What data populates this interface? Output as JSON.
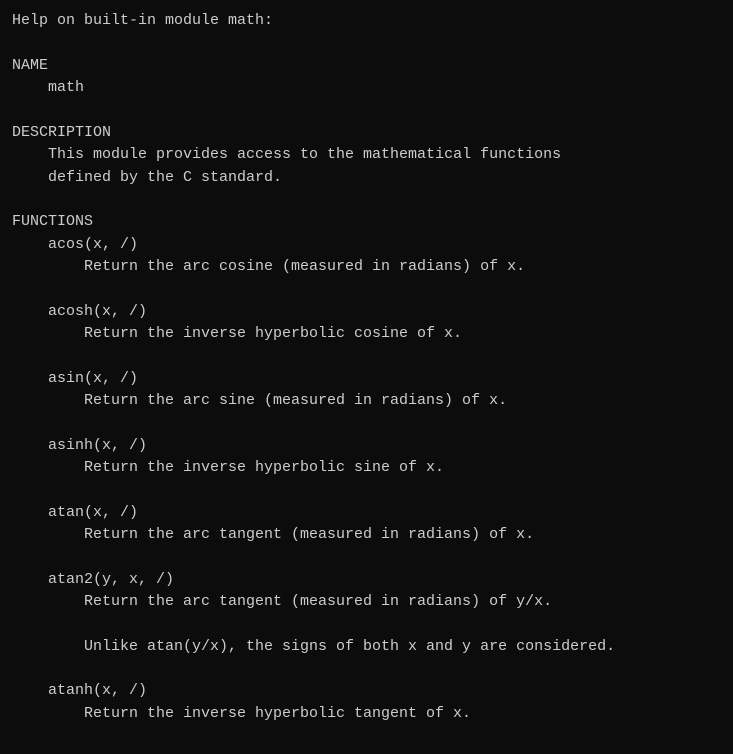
{
  "header": "Help on built-in module math:",
  "sections": {
    "name": {
      "title": "NAME",
      "value": "math"
    },
    "description": {
      "title": "DESCRIPTION",
      "lines": [
        "This module provides access to the mathematical functions",
        "defined by the C standard."
      ]
    },
    "functions": {
      "title": "FUNCTIONS",
      "items": [
        {
          "signature": "acos(x, /)",
          "desc": "Return the arc cosine (measured in radians) of x."
        },
        {
          "signature": "acosh(x, /)",
          "desc": "Return the inverse hyperbolic cosine of x."
        },
        {
          "signature": "asin(x, /)",
          "desc": "Return the arc sine (measured in radians) of x."
        },
        {
          "signature": "asinh(x, /)",
          "desc": "Return the inverse hyperbolic sine of x."
        },
        {
          "signature": "atan(x, /)",
          "desc": "Return the arc tangent (measured in radians) of x."
        },
        {
          "signature": "atan2(y, x, /)",
          "desc": "Return the arc tangent (measured in radians) of y/x.",
          "note": "Unlike atan(y/x), the signs of both x and y are considered."
        },
        {
          "signature": "atanh(x, /)",
          "desc": "Return the inverse hyperbolic tangent of x."
        }
      ]
    }
  }
}
